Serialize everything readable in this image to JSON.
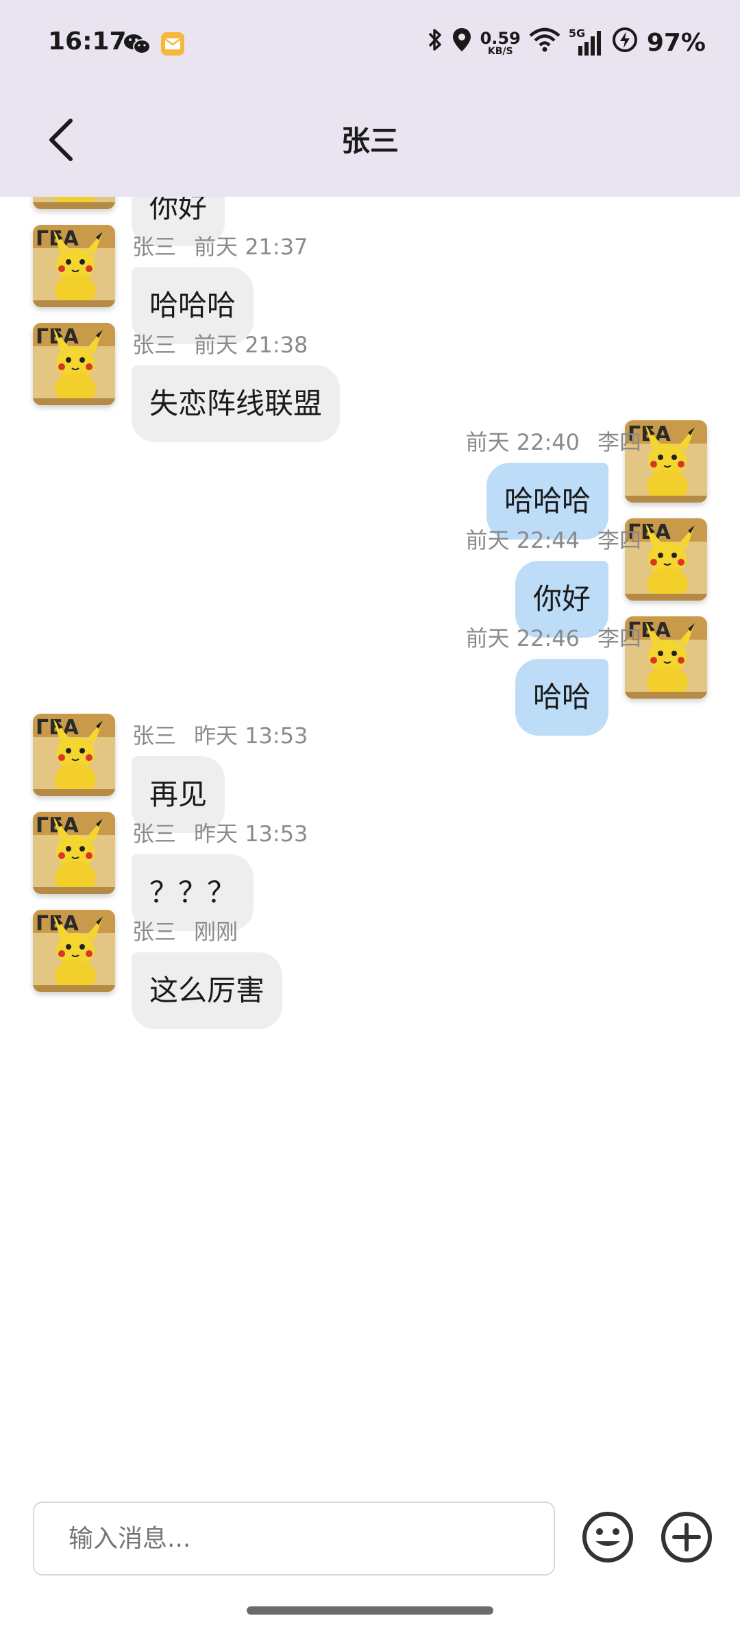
{
  "status_bar": {
    "time": "16:17",
    "left_icons": [
      "wechat-icon",
      "mail-app-icon"
    ],
    "bluetooth": "bluetooth-icon",
    "location": "location-icon",
    "speed_value": "0.59",
    "speed_unit": "KB/S",
    "wifi": "wifi-icon",
    "network": "5G",
    "battery_icon": "battery-charging-icon",
    "battery": "97%"
  },
  "header": {
    "title": "张三",
    "back_icon": "chevron-left-icon"
  },
  "messages": [
    {
      "side": "in",
      "sender": "",
      "time": "",
      "text": "你好"
    },
    {
      "side": "in",
      "sender": "张三",
      "time": "前天 21:37",
      "text": "哈哈哈"
    },
    {
      "side": "in",
      "sender": "张三",
      "time": "前天 21:38",
      "text": "失恋阵线联盟"
    },
    {
      "side": "out",
      "sender": "李四",
      "time": "前天 22:40",
      "text": "哈哈哈"
    },
    {
      "side": "out",
      "sender": "李四",
      "time": "前天 22:44",
      "text": "你好"
    },
    {
      "side": "out",
      "sender": "李四",
      "time": "前天 22:46",
      "text": "哈哈"
    },
    {
      "side": "in",
      "sender": "张三",
      "time": "昨天 13:53",
      "text": "再见"
    },
    {
      "side": "in",
      "sender": "张三",
      "time": "昨天 13:53",
      "text": "？？？"
    },
    {
      "side": "in",
      "sender": "张三",
      "time": "刚刚",
      "text": "这么厉害"
    }
  ],
  "input": {
    "placeholder": "输入消息...",
    "emoji_icon": "emoji-icon",
    "plus_icon": "plus-circle-icon"
  },
  "colors": {
    "header_bg": "#e9e4f0",
    "incoming_bubble": "#eeeeee",
    "outgoing_bubble": "#bcdcf8"
  }
}
